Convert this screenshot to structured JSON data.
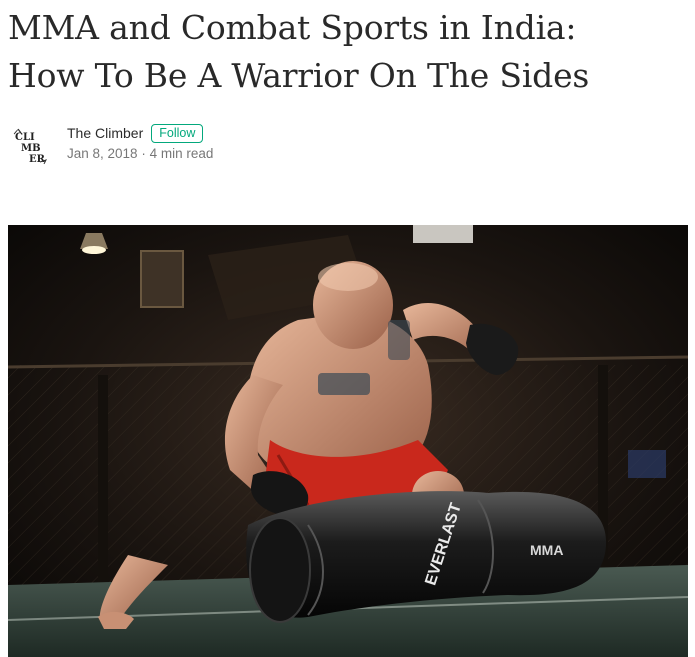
{
  "article": {
    "title_line1": "MMA and Combat Sports in India:",
    "title_line2": "How To Be A Warrior On The Sides"
  },
  "author": {
    "avatar_text": [
      "CLI",
      "MB",
      "ER"
    ],
    "name": "The Climber",
    "follow_label": "Follow",
    "date": "Jan 8, 2018",
    "separator": "·",
    "read_time": "4 min read"
  },
  "hero_image": {
    "description_icon": "mma-fighter-punching-bag-photo",
    "bag_brand": "EVERLAST",
    "bag_label": "MMA"
  },
  "colors": {
    "accent_green": "#03a87c",
    "shorts_red": "#c9281c"
  }
}
